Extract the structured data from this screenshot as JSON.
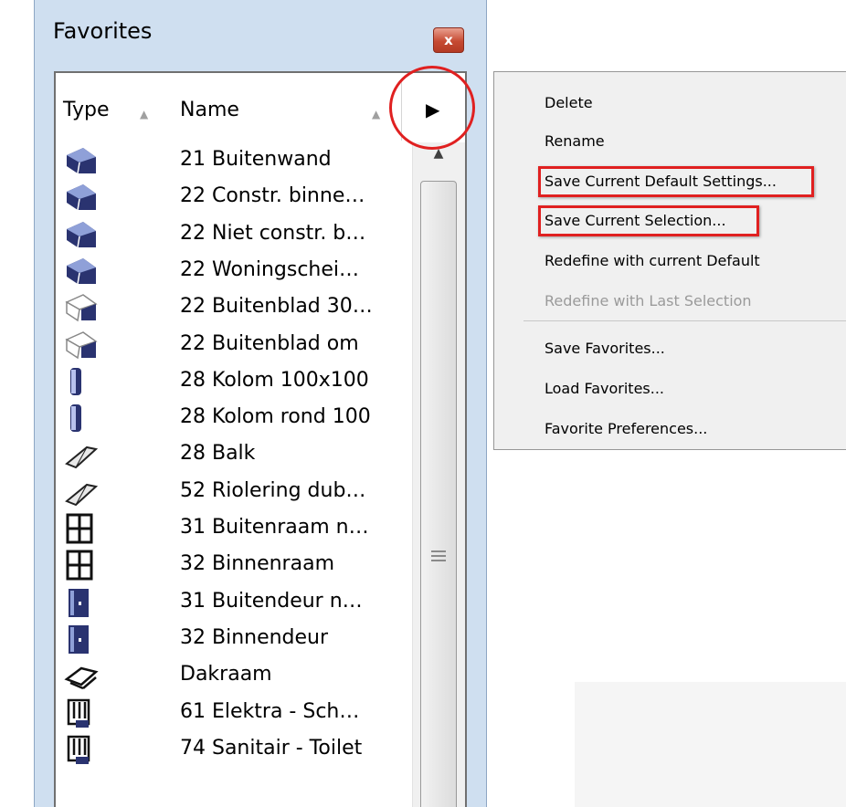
{
  "palette": {
    "title": "Favorites",
    "close_label": "x",
    "columns": {
      "type": "Type",
      "name": "Name"
    },
    "menu_arrow": "▶",
    "scroll_up": "▲",
    "items": [
      {
        "icon": "wall-icon",
        "label": "21 Buitenwand"
      },
      {
        "icon": "wall-icon",
        "label": "22 Constr. binne…"
      },
      {
        "icon": "wall-icon",
        "label": "22 Niet constr. b…"
      },
      {
        "icon": "wall-icon",
        "label": "22 Woningschei…"
      },
      {
        "icon": "wall-outline-icon",
        "label": "22 Buitenblad 30…"
      },
      {
        "icon": "wall-outline-icon",
        "label": "22 Buitenblad om"
      },
      {
        "icon": "column-icon",
        "label": "28 Kolom 100x100"
      },
      {
        "icon": "column-icon",
        "label": "28 Kolom rond 100"
      },
      {
        "icon": "beam-icon",
        "label": "28 Balk"
      },
      {
        "icon": "beam-icon",
        "label": "52 Riolering dub…"
      },
      {
        "icon": "window-icon",
        "label": "31 Buitenraam n…"
      },
      {
        "icon": "window-icon",
        "label": "32 Binnenraam"
      },
      {
        "icon": "door-icon",
        "label": "31 Buitendeur n…"
      },
      {
        "icon": "door-icon",
        "label": "32 Binnendeur"
      },
      {
        "icon": "skylight-icon",
        "label": "Dakraam"
      },
      {
        "icon": "object-icon",
        "label": "61 Elektra - Sch…"
      },
      {
        "icon": "object-icon",
        "label": "74 Sanitair - Toilet"
      }
    ]
  },
  "context_menu": {
    "items": [
      {
        "label": "Delete",
        "enabled": true
      },
      {
        "label": "Rename",
        "enabled": true
      },
      {
        "label": "Save Current Default Settings...",
        "enabled": true,
        "highlighted": true
      },
      {
        "label": "Save Current Selection...",
        "enabled": true,
        "highlighted": true
      },
      {
        "label": "Redefine with current Default",
        "enabled": true
      },
      {
        "label": "Redefine with Last Selection",
        "enabled": false
      },
      {
        "label": "Save Favorites...",
        "enabled": true
      },
      {
        "label": "Load Favorites...",
        "enabled": true
      },
      {
        "label": "Favorite Preferences...",
        "enabled": true
      }
    ]
  },
  "colors": {
    "annotation": "#e02020",
    "palette_bg": "#cfdff0",
    "menu_bg": "#f0f0f0",
    "icon_blue": "#2a3370"
  }
}
